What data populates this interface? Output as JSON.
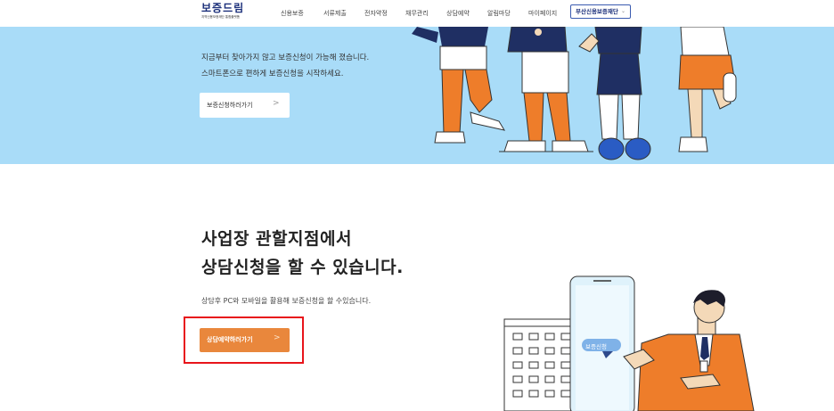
{
  "header": {
    "logo_title": "보증드림",
    "logo_subtitle": "지역신용보증재단 통합플랫폼",
    "nav": [
      "신용보증",
      "서류제출",
      "전자약정",
      "채무관리",
      "상담예약",
      "알림마당",
      "마이페이지"
    ],
    "org_select": "부산신용보증재단"
  },
  "hero": {
    "line1": "지금부터 찾아가지 않고 보증신청이 가능해 졌습니다.",
    "line2": "스마트폰으로 편하게 보증신청을 시작하세요.",
    "button_label": "보증신청하러가기",
    "button_arrow": ">"
  },
  "consult": {
    "title_line1": "사업장 관할지점에서",
    "title_line2": "상담신청을 할 수 있습니다.",
    "description": "상담후 PC와 모바일을 활용해 보증신청을 할 수있습니다.",
    "button_label": "상담예약하러가기",
    "button_arrow": ">",
    "phone_bubble": "보증신청"
  },
  "colors": {
    "hero_bg": "#a9dcf8",
    "accent_orange": "#e9873c",
    "highlight_red": "#e8141b",
    "brand_navy": "#1b2f7a"
  }
}
